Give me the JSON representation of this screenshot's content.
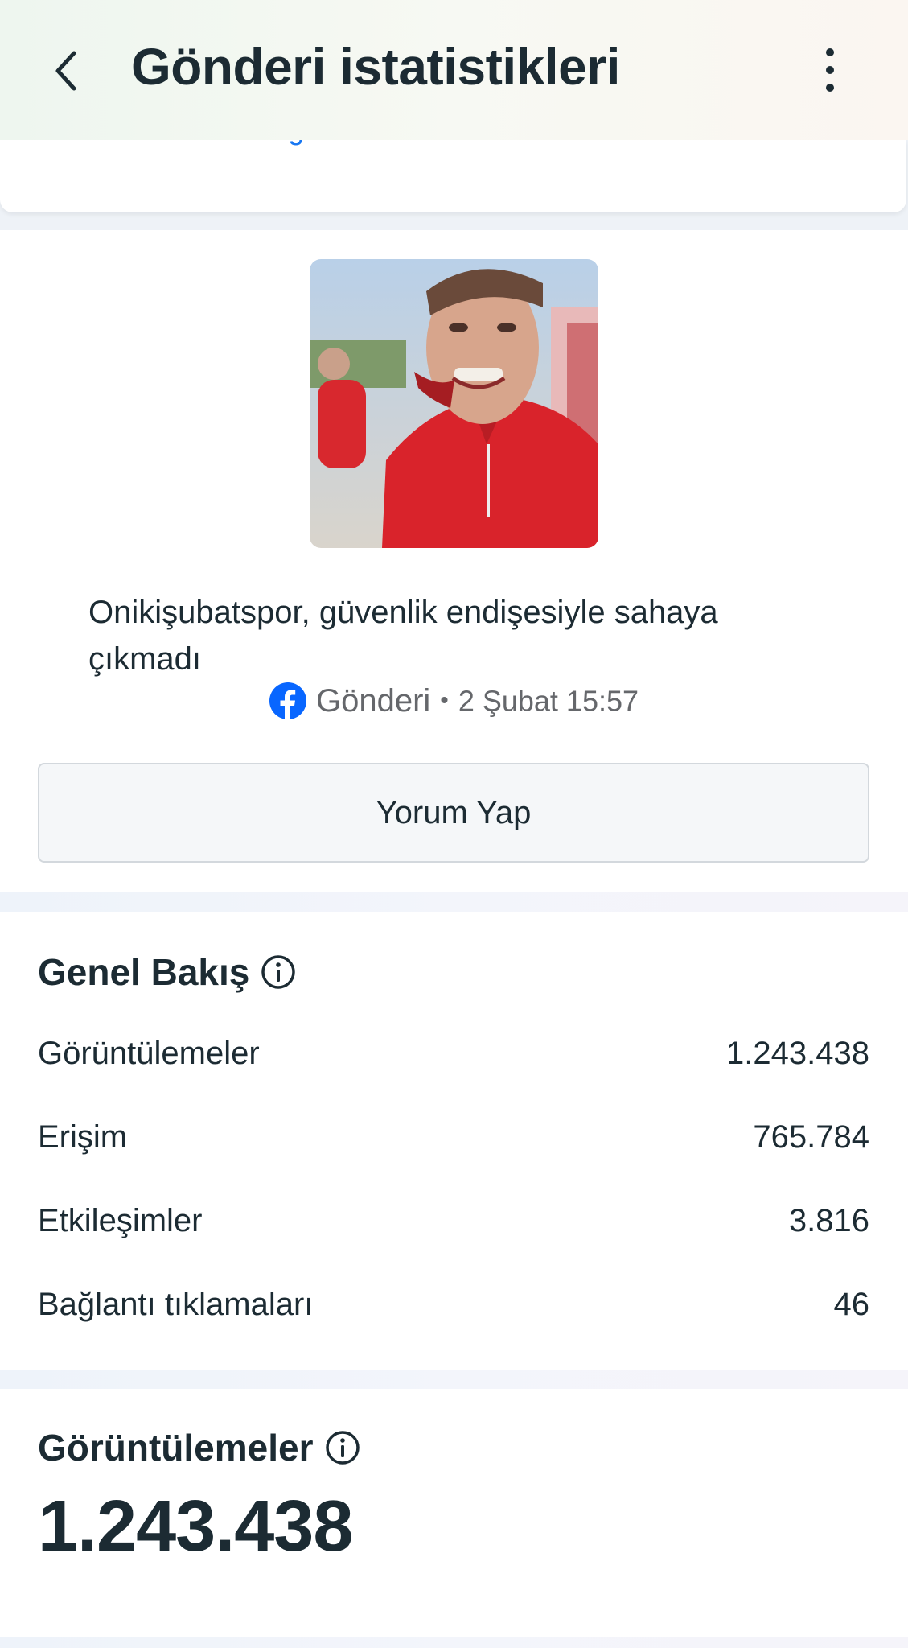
{
  "header": {
    "title": "Gönderi istatistikleri"
  },
  "top_card": {
    "more_info_link": "Daha fazla bilgi al"
  },
  "post": {
    "caption": "Onikişubatspor, güvenlik endişesiyle sahaya çıkmadı",
    "type_label": "Gönderi",
    "separator": "•",
    "date": "2 Şubat 15:57",
    "comment_button": "Yorum Yap"
  },
  "overview": {
    "title": "Genel Bakış",
    "rows": [
      {
        "label": "Görüntülemeler",
        "value": "1.243.438"
      },
      {
        "label": "Erişim",
        "value": "765.784"
      },
      {
        "label": "Etkileşimler",
        "value": "3.816"
      },
      {
        "label": "Bağlantı tıklamaları",
        "value": "46"
      }
    ]
  },
  "views": {
    "title": "Görüntülemeler",
    "total": "1.243.438"
  },
  "colors": {
    "text": "#1c2b33",
    "link": "#1877f2",
    "muted": "#65676b",
    "facebook": "#0866ff"
  }
}
